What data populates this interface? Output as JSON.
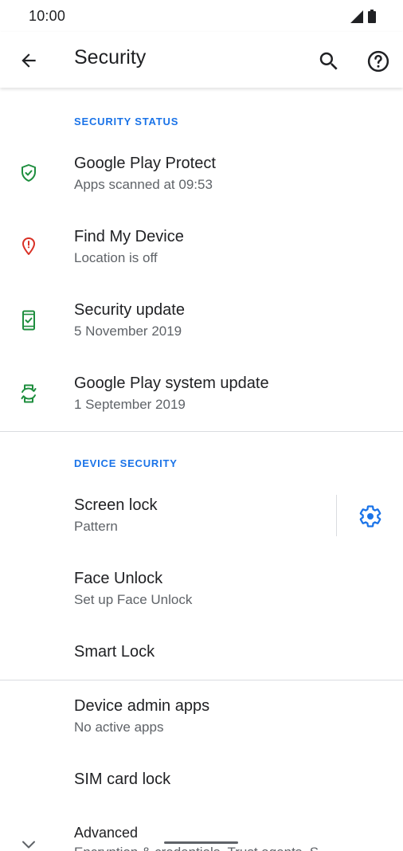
{
  "status_bar": {
    "time": "10:00"
  },
  "app_bar": {
    "title": "Security",
    "back_icon": "arrow-back-icon",
    "search_icon": "search-icon",
    "help_icon": "help-icon"
  },
  "sections": {
    "security_status": "SECURITY STATUS",
    "device_security": "DEVICE SECURITY"
  },
  "rows": {
    "play_protect": {
      "title": "Google Play Protect",
      "subtitle": "Apps scanned at 09:53"
    },
    "find_device": {
      "title": "Find My Device",
      "subtitle": "Location is off"
    },
    "security_update": {
      "title": "Security update",
      "subtitle": "5 November 2019"
    },
    "system_update": {
      "title": "Google Play system update",
      "subtitle": "1 September 2019"
    },
    "screen_lock": {
      "title": "Screen lock",
      "subtitle": "Pattern"
    },
    "face_unlock": {
      "title": "Face Unlock",
      "subtitle": "Set up Face Unlock"
    },
    "smart_lock": {
      "title": "Smart Lock"
    },
    "device_admin": {
      "title": "Device admin apps",
      "subtitle": "No active apps"
    },
    "sim_lock": {
      "title": "SIM card lock"
    },
    "advanced": {
      "title": "Advanced",
      "subtitle": "Encryption & credentials, Trust agents, S..."
    }
  },
  "colors": {
    "accent": "#1a73e8",
    "ok_green": "#1e8e3e",
    "warning_red": "#d93025"
  }
}
